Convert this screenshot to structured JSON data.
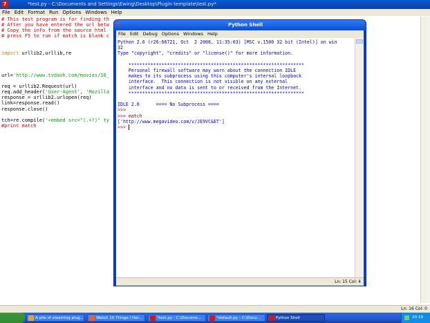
{
  "editor": {
    "title": "*test.py - C:\\Documents and Settings\\Ewing\\Desktop\\Plugin template\\test.py*",
    "menu": [
      "File",
      "Edit",
      "Format",
      "Run",
      "Options",
      "Windows",
      "Help"
    ],
    "code_lines": [
      {
        "cls": "c-comment",
        "text": "# This test program is for finding th"
      },
      {
        "cls": "c-comment",
        "text": "# After you have entered the url betw"
      },
      {
        "cls": "c-comment",
        "text": "# Copy the info from the source html "
      },
      {
        "cls": "c-comment",
        "text": "# press F5 to run if match is blank c"
      },
      {
        "cls": "",
        "text": ""
      },
      {
        "cls": "",
        "text": ""
      },
      {
        "cls": "",
        "html": "<span class=\"c-keyword\">import</span> urllib2,urllib,re"
      },
      {
        "cls": "",
        "text": ""
      },
      {
        "cls": "",
        "text": ""
      },
      {
        "cls": "",
        "text": ""
      },
      {
        "cls": "",
        "html": "url=<span class=\"c-string\">'http://www.tvdash.com/movies/10_</span>"
      },
      {
        "cls": "",
        "text": ""
      },
      {
        "cls": "",
        "text": "req = urllib2.Request(url)"
      },
      {
        "cls": "",
        "html": "req.add_header(<span class=\"c-string\">'User-Agent'</span>, <span class=\"c-string\">'Mozilla</span>"
      },
      {
        "cls": "",
        "text": "response = urllib2.urlopen(req)"
      },
      {
        "cls": "",
        "text": "link=response.read()"
      },
      {
        "cls": "",
        "text": "response.close()"
      },
      {
        "cls": "",
        "text": ""
      },
      {
        "cls": "",
        "html": "tch=re.compile(<span class=\"c-string\">'&lt;embed src=\"(.+?)\" ty</span>"
      },
      {
        "cls": "c-comment",
        "text": "#print match"
      }
    ],
    "status": "Ln: 16 Col: 0"
  },
  "shell": {
    "title": "Python Shell",
    "menu": [
      "File",
      "Edit",
      "Debug",
      "Options",
      "Windows",
      "Help"
    ],
    "lines": [
      {
        "cls": "s-output",
        "text": "Python 2.6 (r26:66721, Oct  2 2008, 11:35:03) [MSC v.1500 32 bit (Intel)] on win"
      },
      {
        "cls": "s-output",
        "text": "32"
      },
      {
        "cls": "s-output",
        "text": "Type \"copyright\", \"credits\" or \"license()\" for more information."
      },
      {
        "cls": "",
        "text": ""
      },
      {
        "cls": "s-output",
        "text": "    ****************************************************************"
      },
      {
        "cls": "s-output",
        "text": "    Personal firewall software may warn about the connection IDLE"
      },
      {
        "cls": "s-output",
        "text": "    makes to its subprocess using this computer's internal loopback"
      },
      {
        "cls": "s-output",
        "text": "    interface.  This connection is not visible on any external"
      },
      {
        "cls": "s-output",
        "text": "    interface and no data is sent to or received from the Internet."
      },
      {
        "cls": "s-output",
        "text": "    ****************************************************************"
      },
      {
        "cls": "",
        "text": ""
      },
      {
        "cls": "s-output",
        "text": "IDLE 2.6      ==== No Subprocess ===="
      },
      {
        "cls": "s-prompt",
        "text": ">>> "
      },
      {
        "cls": "s-prompt",
        "text": ">>> match"
      },
      {
        "cls": "s-output",
        "text": "['http://www.megavideo.com/v/JE9VC&ET']"
      },
      {
        "cls": "s-prompt",
        "text": ">>> ",
        "cursor": true
      }
    ],
    "status": "Ln: 15 Col: 4"
  },
  "taskbar": {
    "items": [
      {
        "label": "A pile of steaming plug...",
        "color": "#e8a32a",
        "active": false
      },
      {
        "label": "Watch 10 Things I Hat...",
        "color": "#e8642a",
        "active": false
      },
      {
        "label": "*test.py - C:\\Docume...",
        "color": "#d01a1a",
        "active": false
      },
      {
        "label": "*default.py - C:\\Docu...",
        "color": "#d01a1a",
        "active": false
      },
      {
        "label": "Python Shell",
        "color": "#d01a1a",
        "active": true
      }
    ],
    "clock": "20:19"
  }
}
